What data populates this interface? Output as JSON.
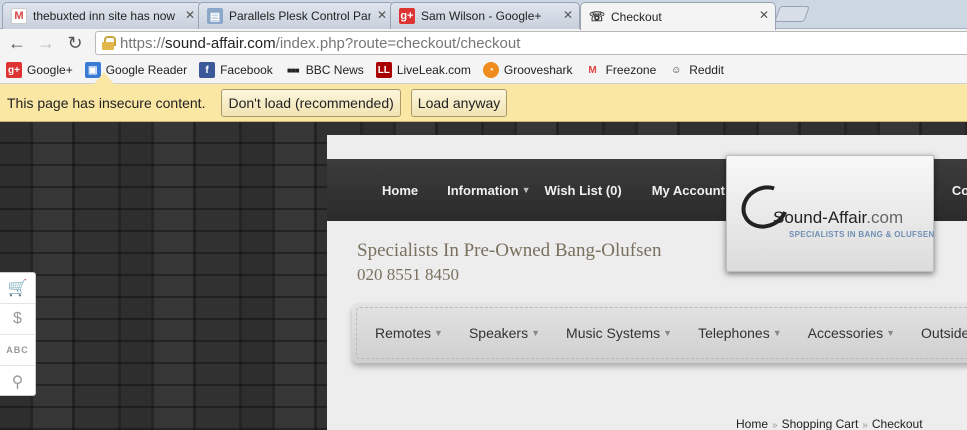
{
  "tabs": [
    {
      "label": "thebuxted inn site has now",
      "icon": "gmail-icon",
      "active": false
    },
    {
      "label": "Parallels Plesk Control Pan",
      "icon": "plesk-icon",
      "active": false
    },
    {
      "label": "Sam Wilson - Google+",
      "icon": "google-plus-icon",
      "active": false
    },
    {
      "label": "Checkout",
      "icon": "phone-favicon-icon",
      "active": true
    }
  ],
  "tab_close": "✕",
  "address": {
    "scheme": "https://",
    "host": "sound-affair.com",
    "path": "/index.php?route=checkout/checkout"
  },
  "bookmarks": [
    {
      "label": "Google+",
      "icon": "google-plus-icon"
    },
    {
      "label": "Google Reader",
      "icon": "google-reader-icon"
    },
    {
      "label": "Facebook",
      "icon": "facebook-icon"
    },
    {
      "label": "BBC News",
      "icon": "bbc-icon"
    },
    {
      "label": "LiveLeak.com",
      "icon": "liveleak-icon"
    },
    {
      "label": "Grooveshark",
      "icon": "grooveshark-icon"
    },
    {
      "label": "Freezone",
      "icon": "gmail-icon"
    },
    {
      "label": "Reddit",
      "icon": "reddit-icon"
    }
  ],
  "infobar": {
    "message": "This page has insecure content.",
    "dont_load": "Don't load (recommended)",
    "load_anyway": "Load anyway"
  },
  "site": {
    "nav": [
      "Home",
      "Information",
      "Wish List (0)",
      "My Account",
      "Co"
    ],
    "logo_name": "Sound-Affair",
    "logo_tld": ".com",
    "logo_tagline": "SPECIALISTS IN BANG & OLUFSEN",
    "tagline": "Specialists In Pre-Owned Bang-Olufsen",
    "phone": "020 8551 8450",
    "categories": [
      "Remotes",
      "Speakers",
      "Music Systems",
      "Telephones",
      "Accessories",
      "Outside Spea"
    ],
    "breadcrumb": [
      "Home",
      "Shopping Cart",
      "Checkout"
    ]
  },
  "colors": {
    "infobar_bg": "#fbe7a4",
    "nav_bg": "#333333",
    "tagline_text": "#7a7060"
  }
}
